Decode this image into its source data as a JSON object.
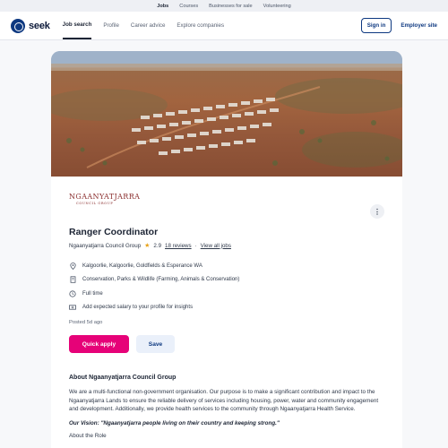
{
  "top_strip": [
    "Jobs",
    "Courses",
    "Businesses for sale",
    "Volunteering"
  ],
  "header": {
    "logo_text": "seek",
    "nav": [
      "Job search",
      "Profile",
      "Career advice",
      "Explore companies"
    ],
    "signin_label": "Sign in",
    "employer_label": "Employer site"
  },
  "company_logo": {
    "line1": "NGAANYATJARRA",
    "line2": "COUNCIL GROUP"
  },
  "job": {
    "title": "Ranger Coordinator",
    "company": "Ngaanyatjarra Council Group",
    "rating": "2.9",
    "reviews": "18 reviews",
    "view_all": "View all jobs",
    "location": "Kalgoorlie, Kalgoorlie, Goldfields & Esperance WA",
    "classification": "Conservation, Parks & Wildlife (Farming, Animals & Conservation)",
    "work_type": "Full time",
    "salary": "Add expected salary to your profile for insights",
    "posted": "Posted 5d ago"
  },
  "actions": {
    "apply_label": "Quick apply",
    "save_label": "Save"
  },
  "about": {
    "title": "About Ngaanyatjarra Council Group",
    "body": "We are a multi-functional non-government organisation. Our purpose is to make a significant contribution and impact to the Ngaanyatjarra Lands to ensure the reliable delivery of services including housing, power, water and community engagement and development. Additionally, we provide health services to the community through Ngaanyatjarra Health Service.",
    "vision": "Our Vision: \"Ngaanyatjarra people living on their country and keeping strong.\"",
    "more": "About the Role"
  },
  "colors": {
    "brand_navy": "#0d3880",
    "apply_pink": "#e60278",
    "star": "#e8a319"
  }
}
